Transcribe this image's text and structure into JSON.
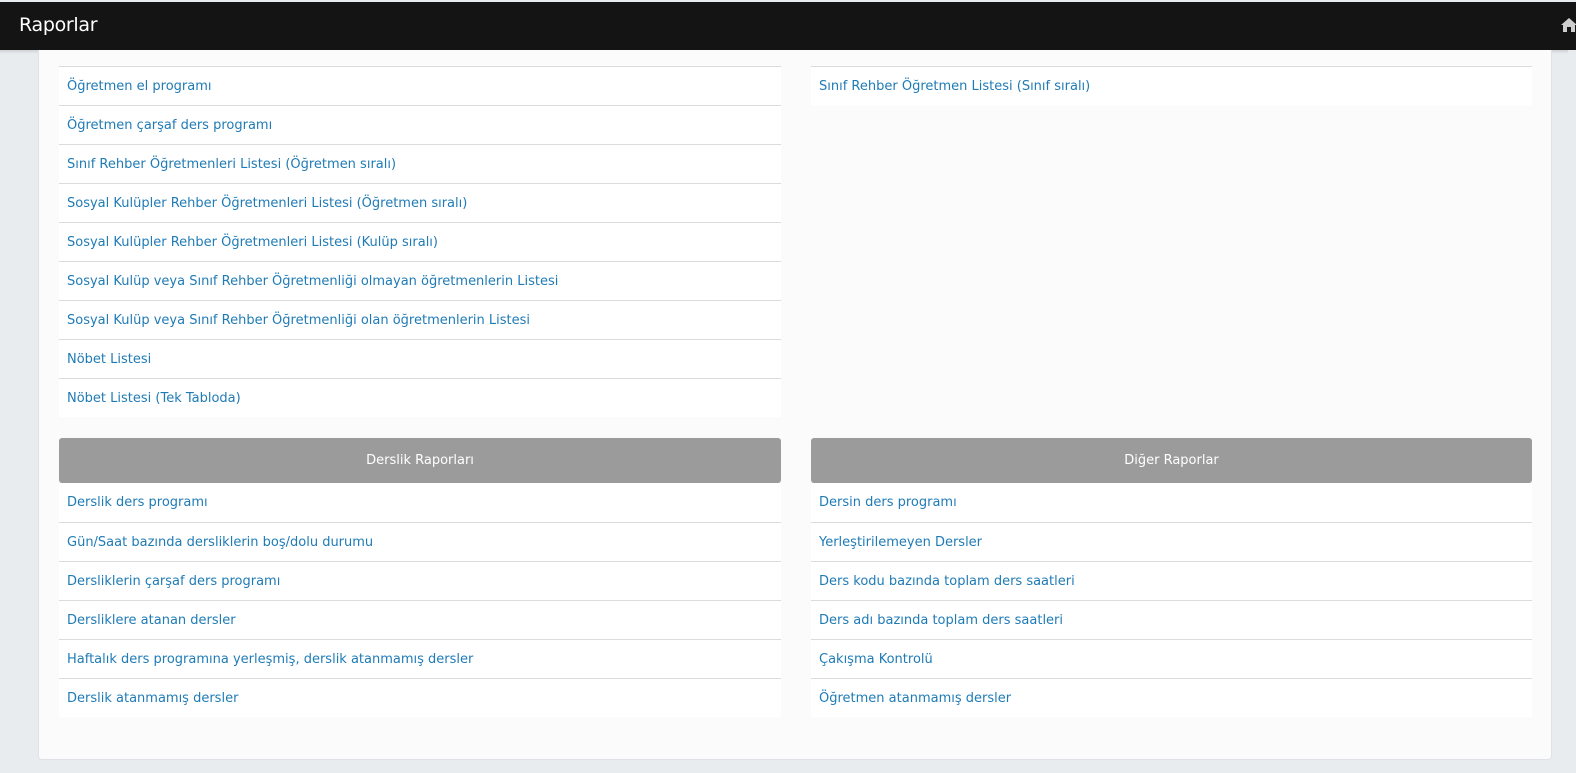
{
  "header": {
    "title": "Raporlar"
  },
  "teacher_reports": {
    "left_items": [
      "Öğretmen el programı",
      "Öğretmen çarşaf ders programı",
      "Sınıf Rehber Öğretmenleri Listesi (Öğretmen sıralı)",
      "Sosyal Kulüpler Rehber Öğretmenleri Listesi (Öğretmen sıralı)",
      "Sosyal Kulüpler Rehber Öğretmenleri Listesi (Kulüp sıralı)",
      "Sosyal Kulüp veya Sınıf Rehber Öğretmenliği olmayan öğretmenlerin Listesi",
      "Sosyal Kulüp veya Sınıf Rehber Öğretmenliği olan öğretmenlerin Listesi",
      "Nöbet Listesi",
      "Nöbet Listesi (Tek Tabloda)"
    ],
    "right_items": [
      "Sınıf Rehber Öğretmen Listesi (Sınıf sıralı)"
    ]
  },
  "classroom_reports": {
    "title": "Derslik Raporları",
    "items": [
      "Derslik ders programı",
      "Gün/Saat bazında dersliklerin boş/dolu durumu",
      "Dersliklerin çarşaf ders programı",
      "Dersliklere atanan dersler",
      "Haftalık ders programına yerleşmiş, derslik atanmamış dersler",
      "Derslik atanmamış dersler"
    ]
  },
  "other_reports": {
    "title": "Diğer Raporlar",
    "items": [
      "Dersin ders programı",
      "Yerleştirilemeyen Dersler",
      "Ders kodu bazında toplam ders saatleri",
      "Ders adı bazında toplam ders saatleri",
      "Çakışma Kontrolü",
      "Öğretmen atanmamış dersler"
    ]
  },
  "icons": {
    "home": "home-icon"
  },
  "colors": {
    "topbar": "#141414",
    "link": "#1f7bb6",
    "section_header": "#9b9b9b"
  }
}
